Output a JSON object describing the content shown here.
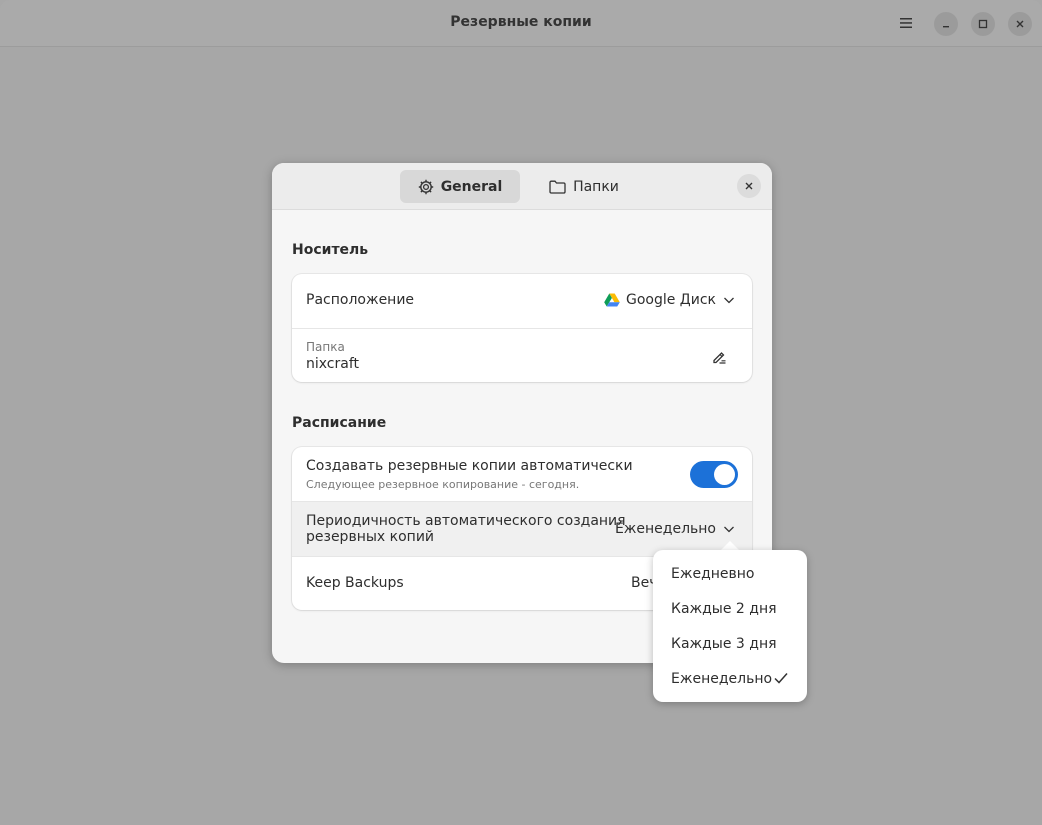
{
  "window": {
    "title": "Резервные копии"
  },
  "dialog": {
    "tabs": [
      {
        "label": "General",
        "icon": "gear-icon",
        "active": true
      },
      {
        "label": "Папки",
        "icon": "folder-icon",
        "active": false
      }
    ],
    "storage": {
      "section_title": "Носитель",
      "location_label": "Расположение",
      "location_value": "Google Диск",
      "location_icon": "google-drive-icon",
      "folder_caption": "Папка",
      "folder_value": "nixcraft"
    },
    "schedule": {
      "section_title": "Расписание",
      "auto_label": "Создавать резервные копии автоматически",
      "auto_sub": "Следующее резервное копирование - сегодня.",
      "auto_enabled": true,
      "frequency_label_line1": "Периодичность автоматического создания",
      "frequency_label_line2": "резервных копий",
      "frequency_value": "Еженедельно",
      "keep_label": "Keep Backups",
      "keep_value": "Веч"
    }
  },
  "frequency_popover": {
    "options": [
      "Ежедневно",
      "Каждые 2 дня",
      "Каждые 3 дня",
      "Еженедельно"
    ],
    "selected": "Еженедельно"
  },
  "colors": {
    "accent": "#1c71d8",
    "dialog_bg": "#f6f6f6",
    "backdrop": "#a7a7a7"
  }
}
